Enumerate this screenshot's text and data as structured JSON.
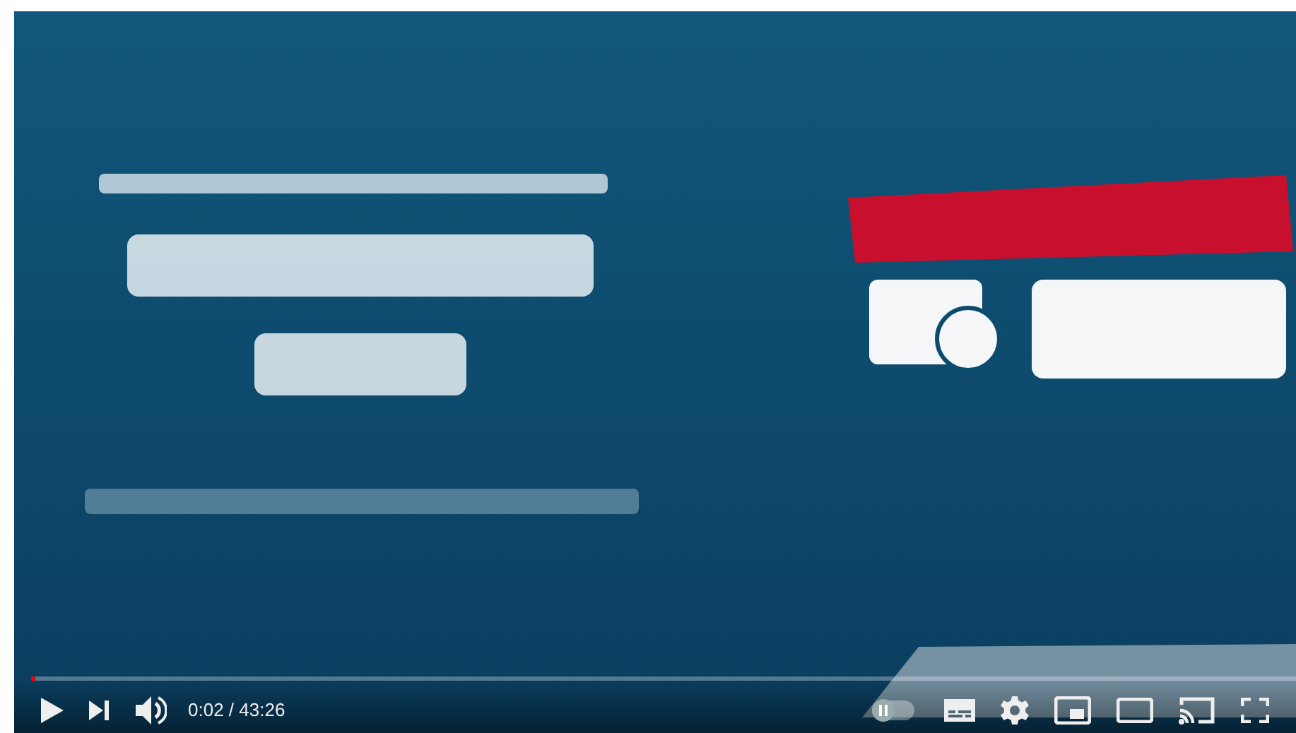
{
  "player": {
    "progress": {
      "level": 0.001
    },
    "time": "0:02 / 43:26",
    "autoplay": {
      "on": false
    }
  }
}
